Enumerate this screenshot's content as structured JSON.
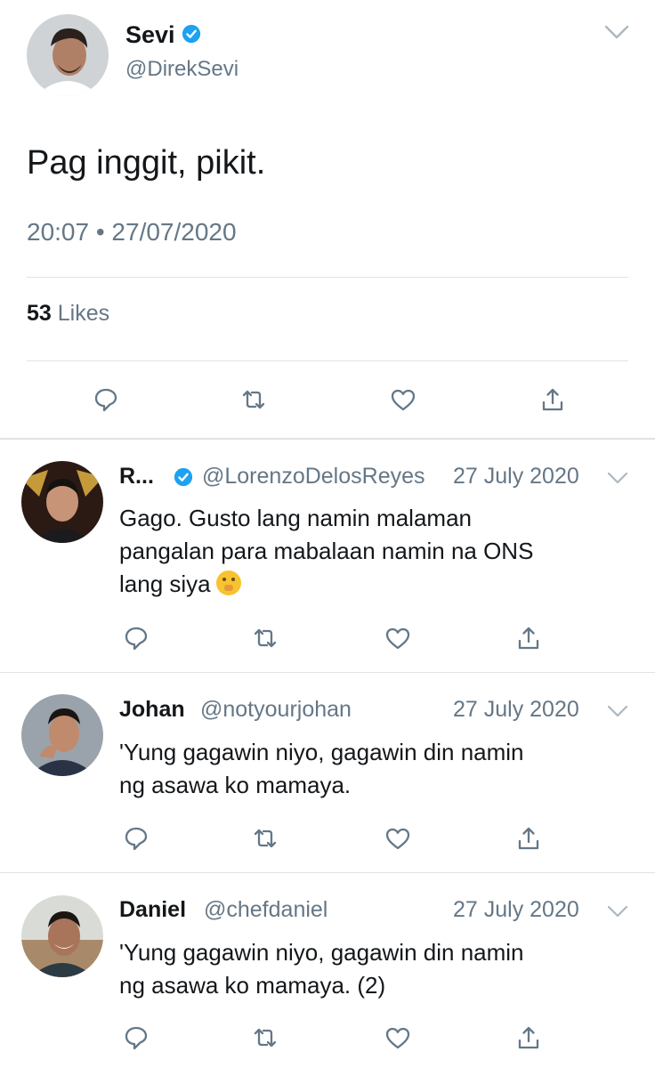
{
  "tweet": {
    "name": "Sevi",
    "handle": "@DirekSevi",
    "text": "Pag inggit, pikit.",
    "timestamp": "20:07 • 27/07/2020",
    "likes_count": "53",
    "likes_label": "Likes"
  },
  "replies": [
    {
      "name": "R...",
      "handle": "@LorenzoDelosReyes",
      "date": "27 July 2020",
      "verified": true,
      "lines": [
        "Gago. Gusto lang namin malaman",
        "pangalan para mabalaan namin na ONS",
        "lang siya"
      ],
      "emoji": "shushing-face-emoji"
    },
    {
      "name": "Johan",
      "handle": "@notyourjohan",
      "date": "27 July 2020",
      "verified": false,
      "lines": [
        "'Yung gagawin niyo, gagawin din namin",
        "ng asawa ko mamaya."
      ]
    },
    {
      "name": "Daniel",
      "handle": "@chefdaniel",
      "date": "27 July 2020",
      "verified": false,
      "lines": [
        "'Yung gagawin niyo, gagawin din namin",
        "ng asawa ko mamaya. (2)"
      ]
    }
  ],
  "icons": {
    "reply": "reply-icon",
    "retweet": "retweet-icon",
    "like": "like-icon",
    "share": "share-icon",
    "verified": "verified-badge-icon",
    "more": "chevron-down-icon"
  },
  "colors": {
    "text": "#14171a",
    "secondary": "#657786",
    "verified": "#1da1f2",
    "divider": "#dfe3e6"
  }
}
